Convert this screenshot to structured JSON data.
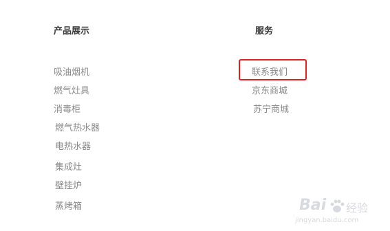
{
  "products": {
    "title": "产品展示",
    "items": [
      {
        "label": "吸油烟机"
      },
      {
        "label": "燃气灶具"
      },
      {
        "label": "消毒柜"
      },
      {
        "label": "燃气热水器"
      },
      {
        "label": "电热水器"
      },
      {
        "label": "集成灶"
      },
      {
        "label": "壁挂炉"
      },
      {
        "label": "蒸烤箱"
      }
    ]
  },
  "service": {
    "title": "服务",
    "items": [
      {
        "label": "联系我们"
      },
      {
        "label": "京东商城"
      },
      {
        "label": "苏宁商城"
      }
    ]
  },
  "watermark": {
    "brand": "Bai",
    "brand_tail": "经验",
    "url": "jingyan.baidu.com"
  },
  "colors": {
    "title": "#3a3a3a",
    "link": "#8a8a8a",
    "highlight": "#e0201c",
    "watermark": "#b8bcc4"
  }
}
